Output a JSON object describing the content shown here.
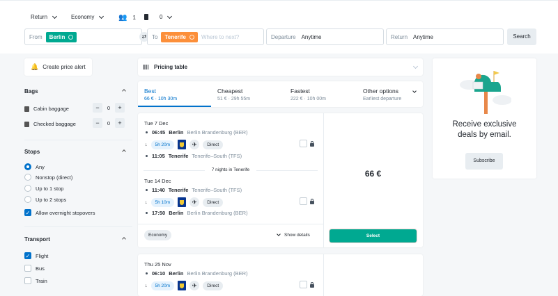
{
  "search": {
    "trip_type": "Return",
    "cabin": "Economy",
    "passengers": "1",
    "bags": "0",
    "from_label": "From",
    "from_value": "Berlin",
    "to_label": "To",
    "to_value": "Tenerife",
    "to_placeholder": "Where to next?",
    "departure_label": "Departure",
    "departure_value": "Anytime",
    "return_label": "Return",
    "return_value": "Anytime",
    "search_button": "Search"
  },
  "sidebar": {
    "price_alert": "Create price alert",
    "bags": {
      "title": "Bags",
      "items": [
        {
          "label": "Cabin baggage",
          "value": "0"
        },
        {
          "label": "Checked baggage",
          "value": "0"
        }
      ]
    },
    "stops": {
      "title": "Stops",
      "options": [
        "Any",
        "Nonstop (direct)",
        "Up to 1 stop",
        "Up to 2 stops"
      ],
      "selected": "Any",
      "overnight": "Allow overnight stopovers"
    },
    "transport": {
      "title": "Transport",
      "options": [
        "Flight",
        "Bus",
        "Train"
      ],
      "checked": [
        "Flight"
      ]
    }
  },
  "pricing_table": "Pricing table",
  "tabs": [
    {
      "label": "Best",
      "sub": "66 € · 10h 30m",
      "active": true
    },
    {
      "label": "Cheapest",
      "sub": "51 € · 29h 55m"
    },
    {
      "label": "Fastest",
      "sub": "222 € · 10h 00m"
    },
    {
      "label": "Other options",
      "sub": "Earliest departure"
    }
  ],
  "results": [
    {
      "price": "66 €",
      "select": "Select",
      "cabin": "Economy",
      "details": "Show details",
      "nights": "7 nights in Tenerife",
      "legs": [
        {
          "date": "Tue 7 Dec",
          "dep_time": "06:45",
          "dep_city": "Berlin",
          "dep_airport": "Berlin Brandenburg (BER)",
          "duration": "5h 20m",
          "type": "Direct",
          "arr_time": "11:05",
          "arr_city": "Tenerife",
          "arr_airport": "Tenerife–South (TFS)"
        },
        {
          "date": "Tue 14 Dec",
          "dep_time": "11:40",
          "dep_city": "Tenerife",
          "dep_airport": "Tenerife–South (TFS)",
          "duration": "5h 10m",
          "type": "Direct",
          "arr_time": "17:50",
          "arr_city": "Berlin",
          "arr_airport": "Berlin Brandenburg (BER)"
        }
      ]
    },
    {
      "legs": [
        {
          "date": "Thu 25 Nov",
          "dep_time": "06:10",
          "dep_city": "Berlin",
          "dep_airport": "Berlin Brandenburg (BER)",
          "duration": "5h 20m",
          "type": "Direct"
        }
      ]
    }
  ],
  "promo": {
    "text": "Receive exclusive deals by email.",
    "button": "Subscribe"
  },
  "colors": {
    "accent": "#0172cb",
    "green": "#00a991",
    "orange": "#fc8f3a"
  }
}
